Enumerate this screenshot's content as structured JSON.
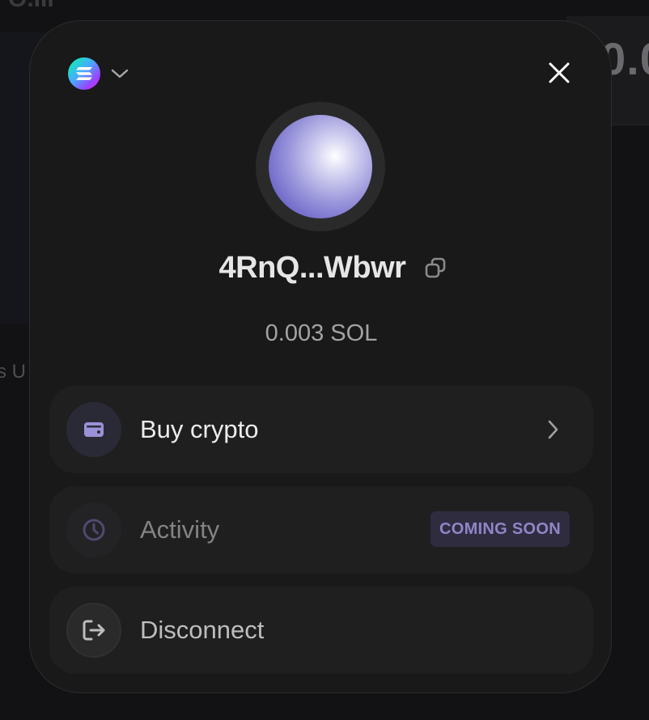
{
  "background": {
    "top_text": "O.III",
    "right_number": "0.0",
    "left_text": "s U"
  },
  "wallet": {
    "chain_icon": "solana-logo-icon",
    "address": "4RnQ...Wbwr",
    "balance": "0.003 SOL"
  },
  "actions": {
    "buy_label": "Buy crypto",
    "activity_label": "Activity",
    "activity_badge": "COMING SOON",
    "disconnect_label": "Disconnect"
  },
  "colors": {
    "modal_bg": "#19191a",
    "card_bg": "#1f1f20",
    "accent": "#8f86c6",
    "badge_bg": "#2f2c40"
  }
}
